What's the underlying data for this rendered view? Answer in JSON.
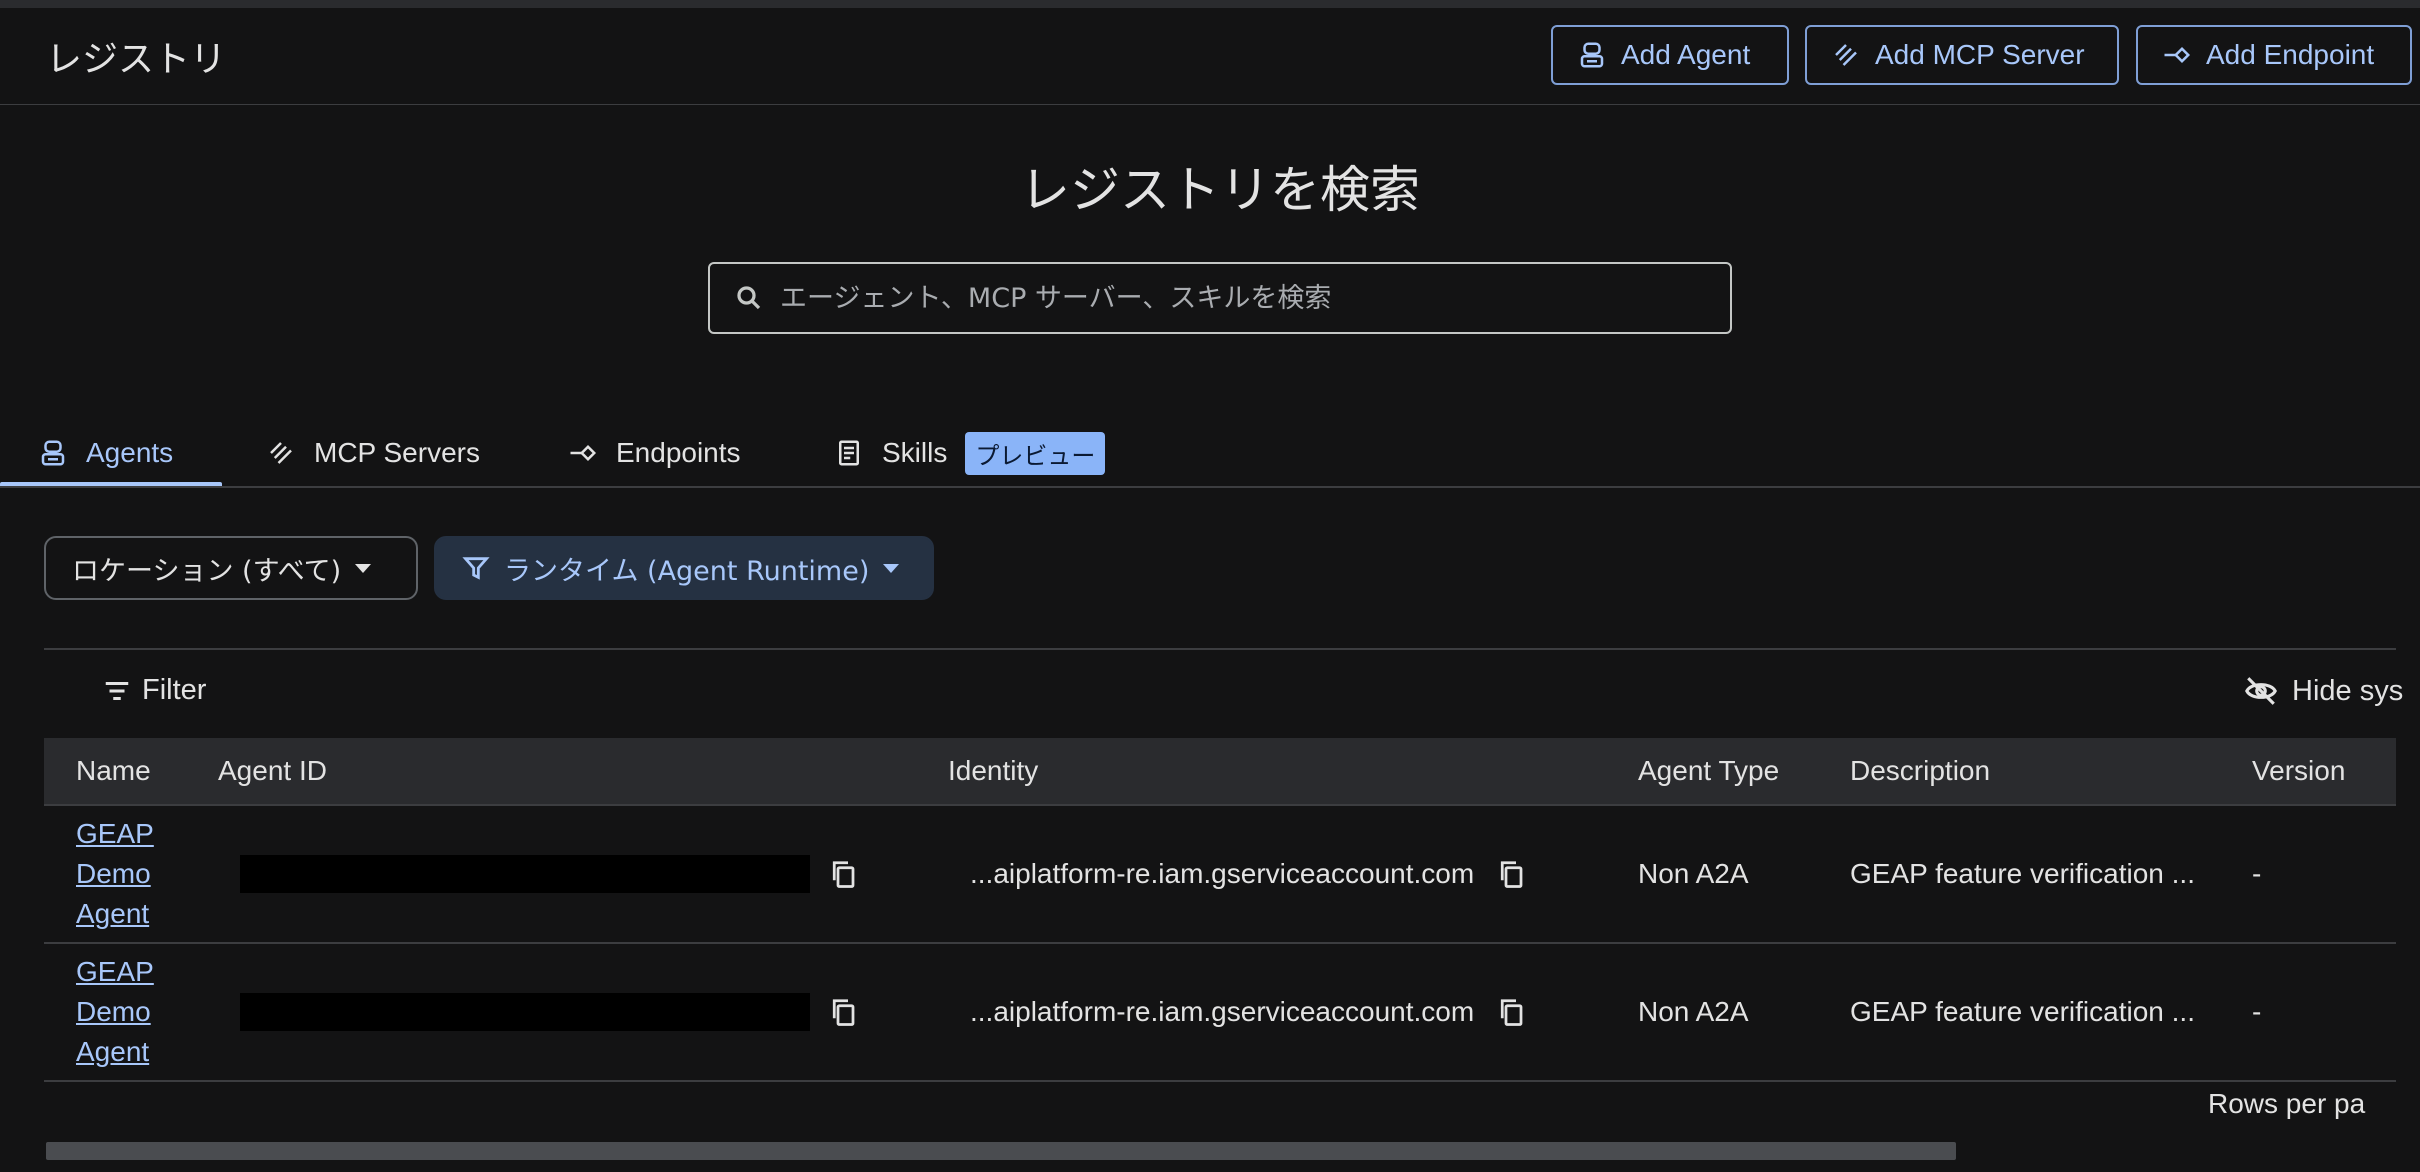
{
  "header": {
    "title": "レジストリ",
    "buttons": {
      "add_agent": "Add Agent",
      "add_mcp_server": "Add MCP Server",
      "add_endpoint": "Add Endpoint"
    }
  },
  "search": {
    "heading": "レジストリを検索",
    "placeholder": "エージェント、MCP サーバー、スキルを検索"
  },
  "tabs": {
    "agents": "Agents",
    "mcp_servers": "MCP Servers",
    "endpoints": "Endpoints",
    "skills": "Skills",
    "skills_badge": "プレビュー",
    "active": "Agents"
  },
  "filters": {
    "location": "ロケーション (すべて)",
    "runtime": "ランタイム (Agent Runtime)"
  },
  "table": {
    "filter_label": "Filter",
    "hide_label": "Hide sys",
    "columns": {
      "name": "Name",
      "agent_id": "Agent ID",
      "identity": "Identity",
      "agent_type": "Agent Type",
      "description": "Description",
      "version": "Version"
    },
    "rows": [
      {
        "name": "GEAP Demo Agent",
        "identity": "...aiplatform-re.iam.gserviceaccount.com",
        "agent_type": "Non A2A",
        "description": "GEAP feature verification ...",
        "version": "-"
      },
      {
        "name": "GEAP Demo Agent",
        "identity": "...aiplatform-re.iam.gserviceaccount.com",
        "agent_type": "Non A2A",
        "description": "GEAP feature verification ...",
        "version": "-"
      }
    ],
    "rows_per_page_label": "Rows per pa"
  },
  "colors": {
    "background": "#131314",
    "accent": "#a8c7fa",
    "header_row": "#2a2b2e",
    "badge": "#8ab4f8"
  },
  "icons": {
    "agent": "agent-icon",
    "mcp": "mcp-server-icon",
    "endpoint": "endpoint-icon",
    "skills": "skills-icon",
    "search": "search-icon",
    "filter": "filter-icon",
    "funnel": "funnel-icon",
    "hide": "visibility-off-icon",
    "copy": "copy-icon"
  }
}
